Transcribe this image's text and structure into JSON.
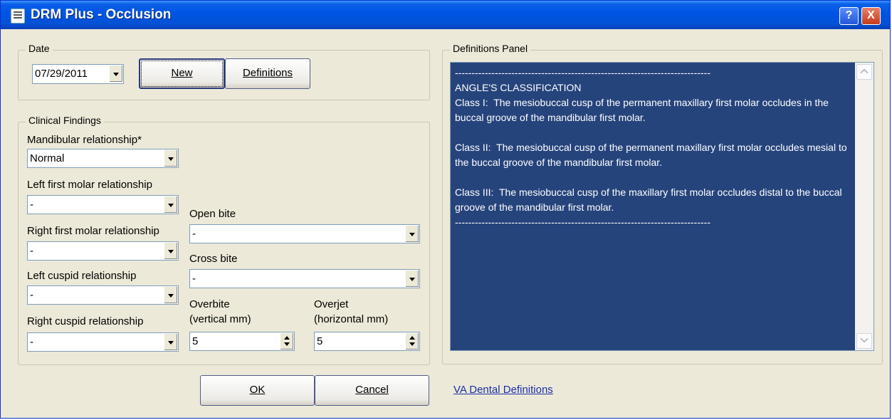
{
  "window": {
    "title": "DRM Plus - Occlusion",
    "help_label": "?",
    "close_label": "X"
  },
  "date_group": {
    "label": "Date",
    "date_value": "07/29/2011",
    "new_button": "New",
    "definitions_button": "Definitions"
  },
  "clinical": {
    "label": "Clinical Findings",
    "mandibular_label": "Mandibular relationship*",
    "mandibular_value": "Normal",
    "left_molar_label": "Left first molar relationship",
    "left_molar_value": "-",
    "right_molar_label": "Right first molar relationship",
    "right_molar_value": "-",
    "left_cuspid_label": "Left cuspid relationship",
    "left_cuspid_value": "-",
    "right_cuspid_label": "Right cuspid relationship",
    "right_cuspid_value": "-",
    "open_bite_label": "Open bite",
    "open_bite_value": "-",
    "cross_bite_label": "Cross bite",
    "cross_bite_value": "-",
    "overbite_label_1": "Overbite",
    "overbite_label_2": "(vertical mm)",
    "overbite_value": "5",
    "overjet_label_1": "Overjet",
    "overjet_label_2": "(horizontal mm)",
    "overjet_value": "5"
  },
  "definitions_panel": {
    "label": "Definitions Panel",
    "text": "-----------------------------------------------------------------------------\nANGLE'S CLASSIFICATION\nClass I:  The mesiobuccal cusp of the permanent maxillary first molar occludes in the buccal groove of the mandibular first molar.\n\nClass II:  The mesiobuccal cusp of the permanent maxillary first molar occludes mesial to the buccal groove of the mandibular first molar.\n\nClass III:  The mesiobuccal cusp of the maxillary first molar occludes distal to the buccal groove of the mandibular first molar.\n-----------------------------------------------------------------------------"
  },
  "footer": {
    "ok_button": "OK",
    "cancel_button": "Cancel",
    "link": "VA Dental Definitions"
  },
  "colors": {
    "titlebar": "#0054e3",
    "panel_background": "#26447c",
    "dialog_background": "#ece9d8"
  }
}
